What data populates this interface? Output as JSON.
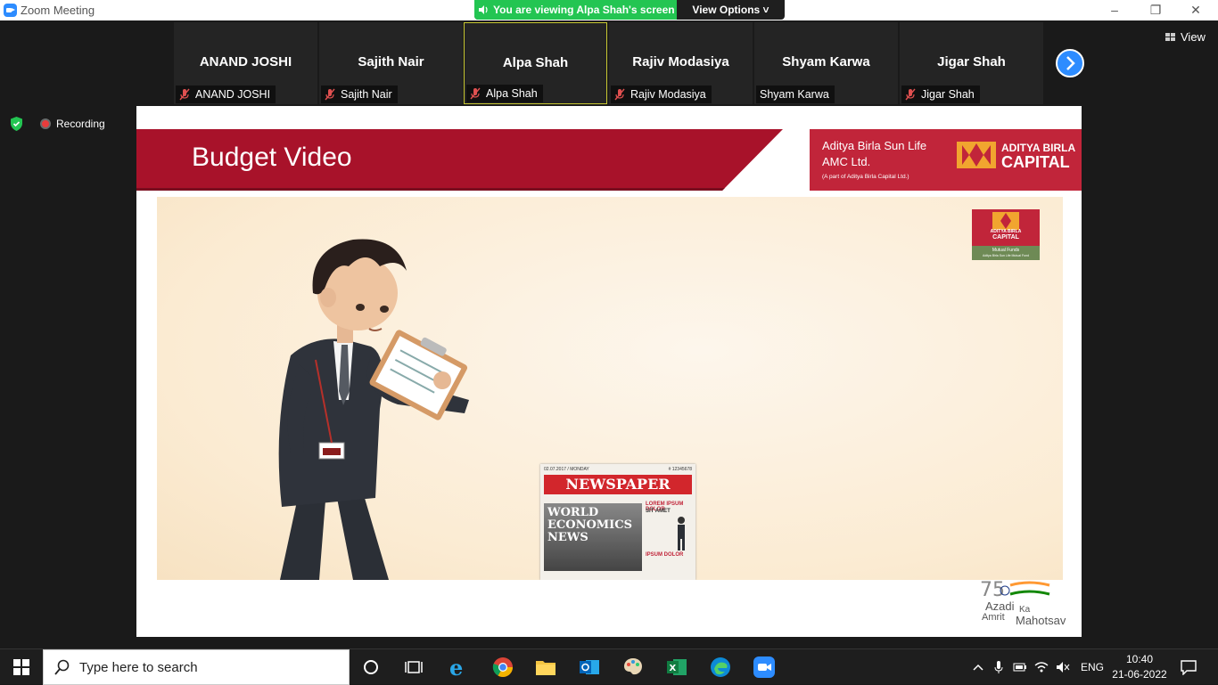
{
  "window": {
    "title": "Zoom Meeting",
    "minimize_glyph": "–",
    "restore_glyph": "❐",
    "close_glyph": "✕"
  },
  "share_banner": {
    "viewing_text": "You are viewing Alpa Shah's screen",
    "view_options": "View Options ˅"
  },
  "participants": [
    {
      "name": "ANAND JOSHI",
      "label": "ANAND JOSHI",
      "muted": true,
      "active": false
    },
    {
      "name": "Sajith Nair",
      "label": "Sajith Nair",
      "muted": true,
      "active": false
    },
    {
      "name": "Alpa Shah",
      "label": "Alpa Shah",
      "muted": true,
      "active": true
    },
    {
      "name": "Rajiv Modasiya",
      "label": "Rajiv Modasiya",
      "muted": true,
      "active": false
    },
    {
      "name": "Shyam Karwa",
      "label": "Shyam Karwa",
      "muted": false,
      "active": false
    },
    {
      "name": "Jigar Shah",
      "label": "Jigar Shah",
      "muted": true,
      "active": false
    }
  ],
  "view_button": "View",
  "recording": "Recording",
  "slide": {
    "title": "Budget Video",
    "company_line1": "Aditya Birla Sun Life",
    "company_line2": "AMC Ltd.",
    "company_line3": "(A part of Aditya Birla Capital Ltd.)",
    "brand_top": "ADITYA BIRLA",
    "brand_bottom": "CAPITAL",
    "mf_logo": {
      "l1": "ADITYA BIRLA",
      "l2": "CAPITAL",
      "l3": "Mutual Funds",
      "l4": "Aditya Birla Sun Life Mutual Fund"
    },
    "newspaper": {
      "date": "02.07.2017 / MONDAY",
      "page": "# 12345678",
      "masthead": "NEWSPAPER",
      "headline": "WORLD ECONOMICS NEWS",
      "right1": "LOREM IPSUM DOLOR",
      "right2": "SIT AMET",
      "right3": "IPSUM DOLOR"
    },
    "azadi": {
      "line1": "Azadi",
      "line2": "Ka",
      "line3": "Amrit",
      "line4": "Mahotsav"
    }
  },
  "taskbar": {
    "search_placeholder": "Type here to search",
    "lang": "ENG",
    "time": "10:40",
    "date": "21-06-2022"
  },
  "colors": {
    "zoom_blue": "#2d8cff",
    "share_green": "#23c552",
    "brand_red": "#c1253a",
    "banner_red": "#a8122a"
  }
}
